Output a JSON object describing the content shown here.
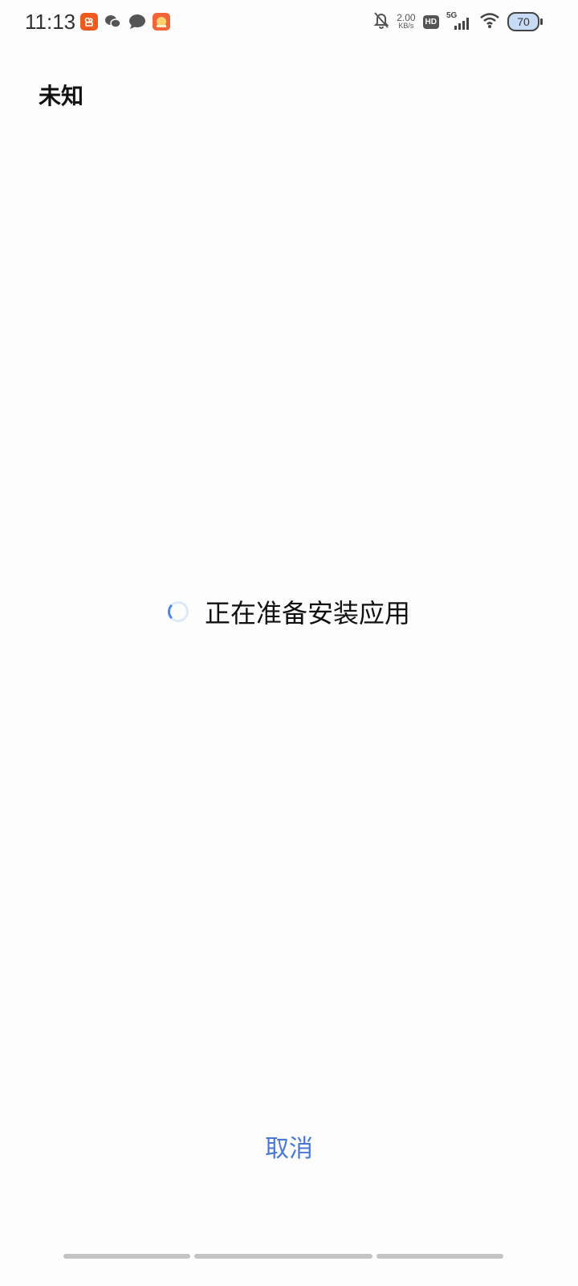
{
  "status_bar": {
    "time": "11:13",
    "net_speed_value": "2.00",
    "net_speed_unit": "KB/s",
    "hd_label": "HD",
    "signal_label": "5G",
    "battery_level": "70"
  },
  "header": {
    "title": "未知"
  },
  "main": {
    "loading_text": "正在准备安装应用"
  },
  "footer": {
    "cancel_label": "取消"
  },
  "colors": {
    "accent": "#4a78d2",
    "spinner": "#4d86e8"
  }
}
